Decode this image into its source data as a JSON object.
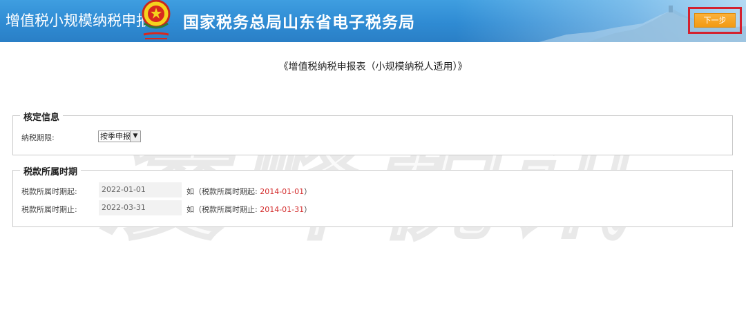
{
  "header": {
    "system_title": "增值税小规模纳税申报",
    "bureau_name": "国家税务总局山东省电子税务局",
    "emblem_icon": "tax-emblem-icon",
    "next_button_label": "下一步",
    "next_highlight_color": "#d3212f",
    "next_button_color": "#f5a623"
  },
  "form": {
    "title": "《增值税纳税申报表（小规模纳税人适用）》"
  },
  "section_verify": {
    "legend": "核定信息",
    "period_label": "纳税期限:",
    "period_selected": "按季申报"
  },
  "section_period": {
    "legend": "税款所属时期",
    "start_label": "税款所属时期起:",
    "start_value": "2022-01-01",
    "start_hint_prefix": "如（税款所属时期起: ",
    "start_hint_example": "2014-01-01",
    "start_hint_suffix": "）",
    "end_label": "税款所属时期止:",
    "end_value": "2022-03-31",
    "end_hint_prefix": "如（税款所属时期止: ",
    "end_hint_example": "2014-01-31",
    "end_hint_suffix": "）"
  },
  "watermark": {
    "text": "凌峰税讯"
  }
}
